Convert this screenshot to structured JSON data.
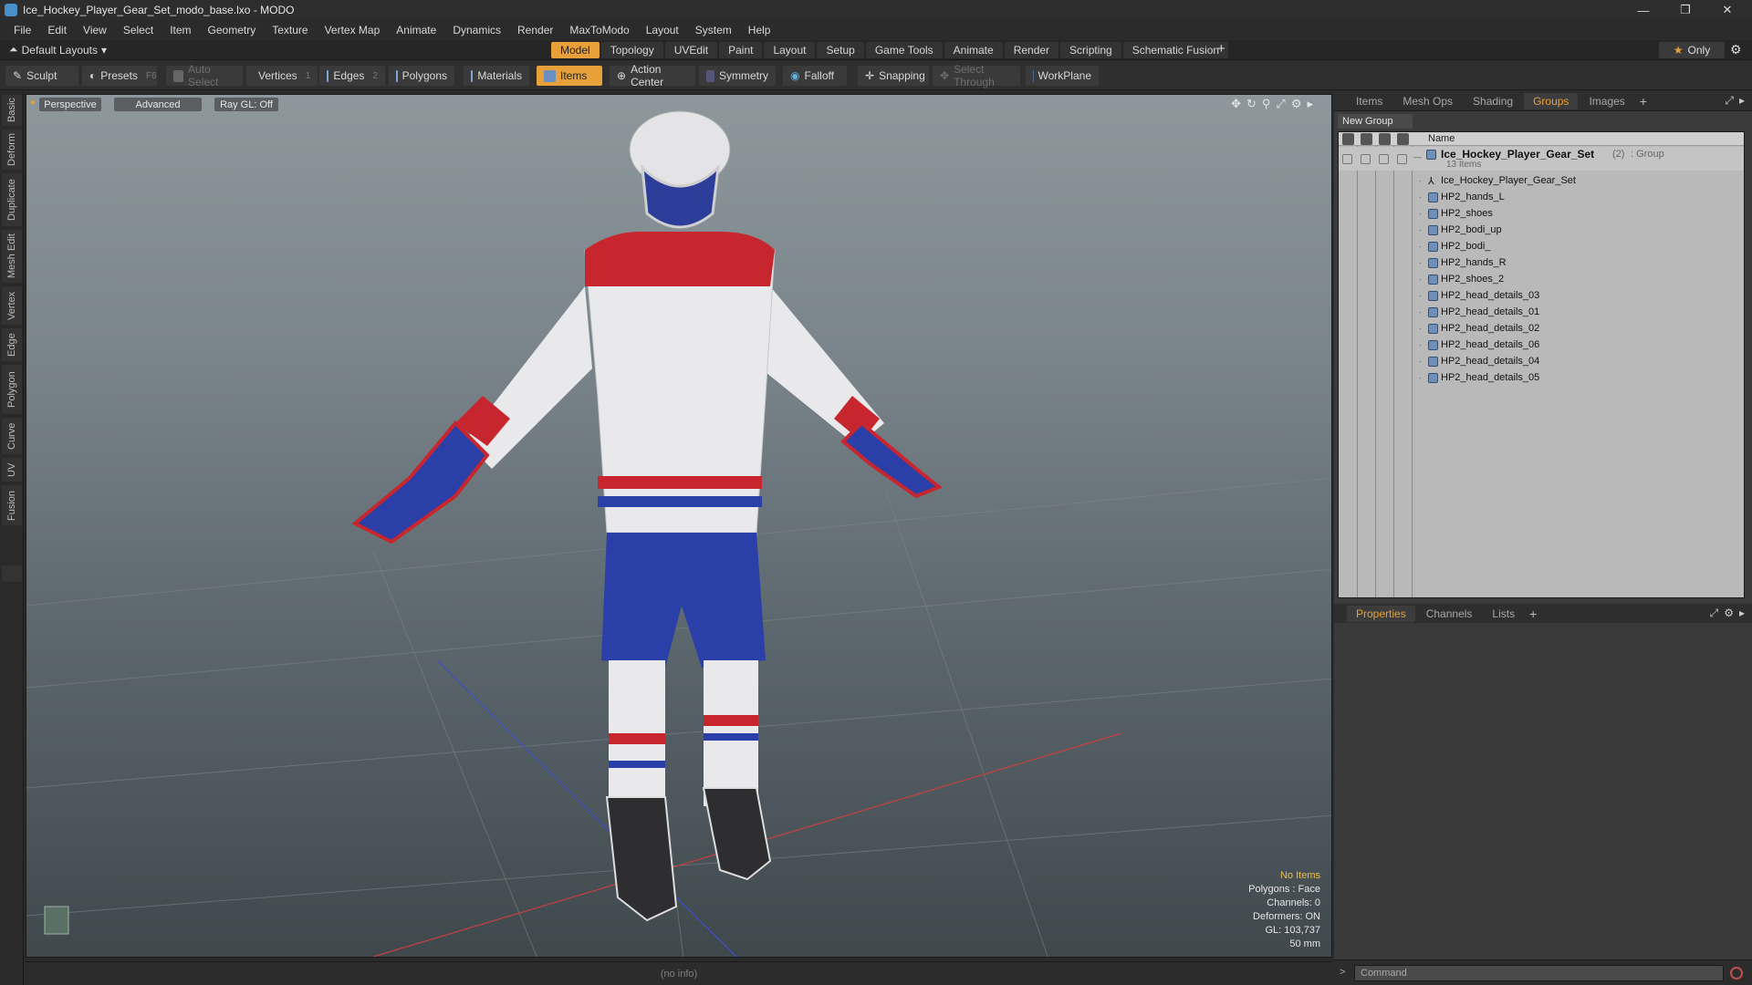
{
  "window": {
    "title": "Ice_Hockey_Player_Gear_Set_modo_base.lxo - MODO",
    "controls": [
      "—",
      "❐",
      "✕"
    ]
  },
  "menu": [
    "File",
    "Edit",
    "View",
    "Select",
    "Item",
    "Geometry",
    "Texture",
    "Vertex Map",
    "Animate",
    "Dynamics",
    "Render",
    "MaxToModo",
    "Layout",
    "System",
    "Help"
  ],
  "layoutbar": {
    "layouts_label": "Default Layouts",
    "tabs": [
      "Model",
      "Topology",
      "UVEdit",
      "Paint",
      "Layout",
      "Setup",
      "Game Tools",
      "Animate",
      "Render",
      "Scripting",
      "Schematic Fusion"
    ],
    "active_tab": "Model",
    "only_label": "Only",
    "plus": "+"
  },
  "toolbar": {
    "sculpt": "Sculpt",
    "presets": "Presets",
    "presets_key": "F6",
    "auto_select": "Auto Select",
    "vertices": "Vertices",
    "vertices_key": "1",
    "edges": "Edges",
    "edges_key": "2",
    "polygons": "Polygons",
    "materials": "Materials",
    "items": "Items",
    "action_center": "Action Center",
    "symmetry": "Symmetry",
    "falloff": "Falloff",
    "snapping": "Snapping",
    "select_through": "Select Through",
    "workplane": "WorkPlane"
  },
  "left_tabs": [
    "Basic",
    "Deform",
    "Duplicate",
    "Mesh Edit",
    "Vertex",
    "Edge",
    "Polygon",
    "Curve",
    "UV",
    "Fusion"
  ],
  "viewport": {
    "view_mode": "Perspective",
    "shading": "Advanced",
    "raygl": "Ray GL: Off",
    "info": {
      "selection": "No Items",
      "polygons": "Polygons : Face",
      "channels": "Channels: 0",
      "deformers": "Deformers: ON",
      "gl": "GL: 103,737",
      "scale": "50 mm"
    }
  },
  "status": "(no info)",
  "groups_panel": {
    "tabs": [
      "Items",
      "Mesh Ops",
      "Shading",
      "Groups",
      "Images"
    ],
    "active_tab": "Groups",
    "new_group": "New Group",
    "column_name": "Name",
    "group": {
      "name": "Ice_Hockey_Player_Gear_Set",
      "count": "(2)",
      "type": ": Group",
      "sub": "13 Items"
    },
    "items": [
      "Ice_Hockey_Player_Gear_Set",
      "HP2_hands_L",
      "HP2_shoes",
      "HP2_bodi_up",
      "HP2_bodi_",
      "HP2_hands_R",
      "HP2_shoes_2",
      "HP2_head_details_03",
      "HP2_head_details_01",
      "HP2_head_details_02",
      "HP2_head_details_06",
      "HP2_head_details_04",
      "HP2_head_details_05"
    ]
  },
  "props_panel": {
    "tabs": [
      "Properties",
      "Channels",
      "Lists"
    ],
    "active_tab": "Properties"
  },
  "command": {
    "placeholder": "Command"
  },
  "colors": {
    "accent": "#e8a13a",
    "jersey_red": "#c8262e",
    "jersey_blue": "#2a3fa8",
    "jersey_white": "#e9e9ec"
  }
}
